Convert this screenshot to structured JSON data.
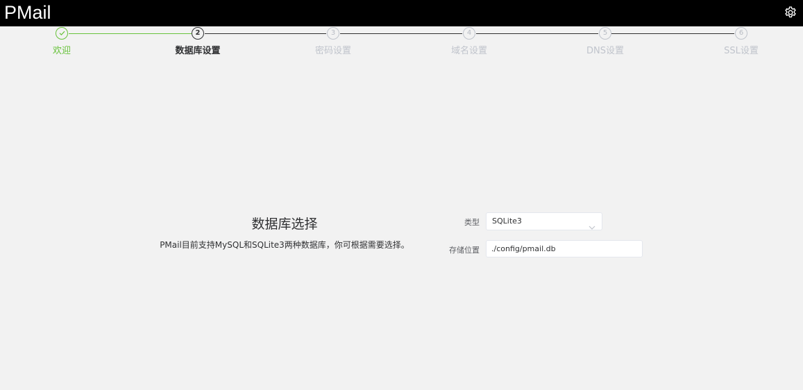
{
  "app": {
    "title": "PMail"
  },
  "icons": {
    "settings": "gear-icon",
    "success": "check-icon",
    "select_arrow": "chevron-down-icon"
  },
  "colors": {
    "success": "#67c23a",
    "process": "#303133",
    "wait": "#c0c4cc",
    "header": "#000000"
  },
  "steps": [
    {
      "number": "",
      "title": "欢迎",
      "status": "success"
    },
    {
      "number": "2",
      "title": "数据库设置",
      "status": "process"
    },
    {
      "number": "3",
      "title": "密码设置",
      "status": "wait"
    },
    {
      "number": "4",
      "title": "域名设置",
      "status": "wait"
    },
    {
      "number": "5",
      "title": "DNS设置",
      "status": "wait"
    },
    {
      "number": "6",
      "title": "SSL设置",
      "status": "wait"
    }
  ],
  "database": {
    "title": "数据库选择",
    "description": "PMail目前支持MySQL和SQLite3两种数据库，你可根据需要选择。",
    "type_label": "类型",
    "type_value": "SQLite3",
    "path_label": "存储位置",
    "path_value": "./config/pmail.db"
  }
}
